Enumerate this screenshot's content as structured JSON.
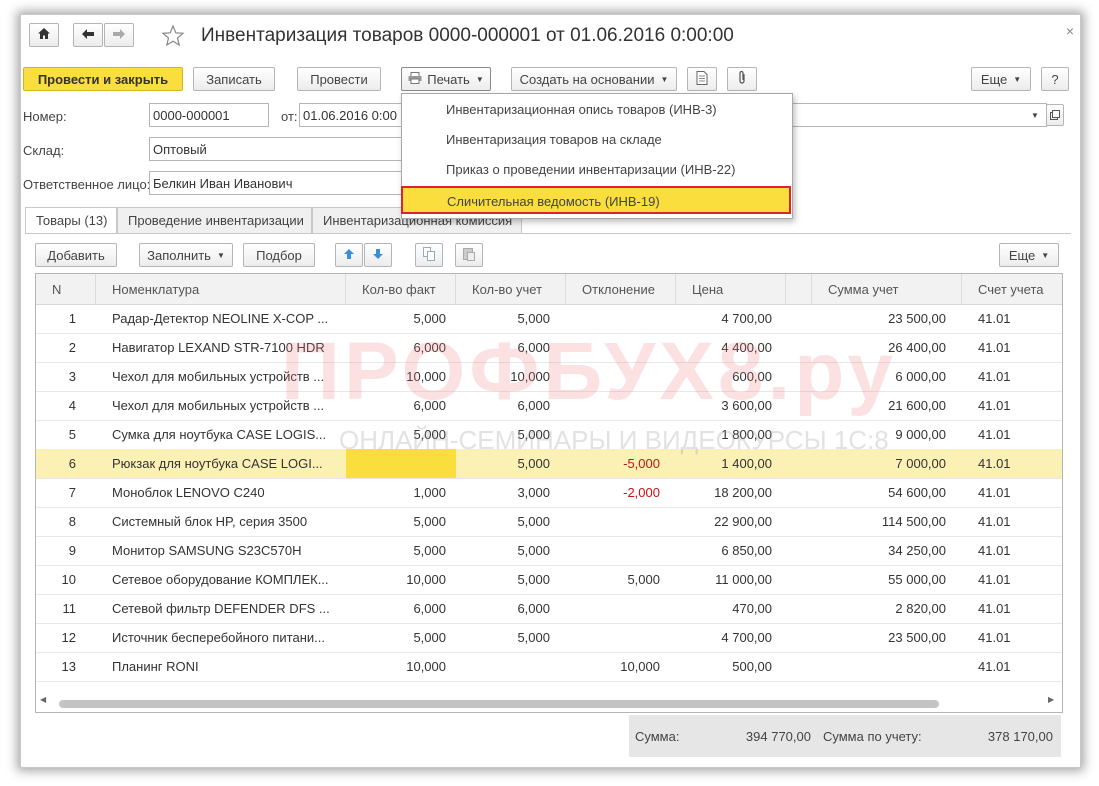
{
  "header": {
    "home_icon": "home-icon",
    "back_icon": "arrow-left-icon",
    "forward_icon": "arrow-right-icon",
    "star_icon": "star-icon",
    "title": "Инвентаризация товаров 0000-000001 от 01.06.2016 0:00:00",
    "close": "×"
  },
  "toolbar": {
    "post_close": "Провести и закрыть",
    "save": "Записать",
    "post": "Провести",
    "print": "Печать",
    "create_based": "Создать на основании",
    "more": "Еще",
    "help": "?"
  },
  "print_menu": {
    "items": [
      "Инвентаризационная опись товаров (ИНВ-3)",
      "Инвентаризация товаров на складе",
      "Приказ о проведении инвентаризации (ИНВ-22)",
      "Сличительная ведомость (ИНВ-19)"
    ],
    "highlighted_index": 3
  },
  "form": {
    "number_label": "Номер:",
    "number_value": "0000-000001",
    "from_label": "от:",
    "date_value": "01.06.2016  0:00",
    "warehouse_label": "Склад:",
    "warehouse_value": "Оптовый",
    "responsible_label": "Ответственное лицо:",
    "responsible_value": "Белкин Иван Иванович"
  },
  "tabs": [
    "Товары (13)",
    "Проведение инвентаризации",
    "Инвентаризационная комиссия"
  ],
  "table_toolbar": {
    "add": "Добавить",
    "fill": "Заполнить",
    "select": "Подбор",
    "more": "Еще"
  },
  "table": {
    "columns": [
      "N",
      "Номенклатура",
      "Кол-во факт",
      "Кол-во учет",
      "Отклонение",
      "Цена",
      "Сумма учет",
      "Счет учета"
    ],
    "rows": [
      [
        "1",
        "Радар-Детектор NEOLINE X-COP ...",
        "5,000",
        "5,000",
        "",
        "4 700,00",
        "23 500,00",
        "41.01"
      ],
      [
        "2",
        "Навигатор LEXAND STR-7100 HDR",
        "6,000",
        "6,000",
        "",
        "4 400,00",
        "26 400,00",
        "41.01"
      ],
      [
        "3",
        "Чехол для мобильных устройств  ...",
        "10,000",
        "10,000",
        "",
        "600,00",
        "6 000,00",
        "41.01"
      ],
      [
        "4",
        "Чехол для мобильных устройств  ...",
        "6,000",
        "6,000",
        "",
        "3 600,00",
        "21 600,00",
        "41.01"
      ],
      [
        "5",
        "Сумка для ноутбука CASE LOGIS...",
        "5,000",
        "5,000",
        "",
        "1 800,00",
        "9 000,00",
        "41.01"
      ],
      [
        "6",
        "Рюкзак для ноутбука CASE LOGI...",
        "",
        "5,000",
        "-5,000",
        "1 400,00",
        "7 000,00",
        "41.01"
      ],
      [
        "7",
        "Моноблок  LENOVO C240",
        "1,000",
        "3,000",
        "-2,000",
        "18 200,00",
        "54 600,00",
        "41.01"
      ],
      [
        "8",
        "Системный блок HP, серия 3500",
        "5,000",
        "5,000",
        "",
        "22 900,00",
        "114 500,00",
        "41.01"
      ],
      [
        "9",
        "Монитор  SAMSUNG S23C570H",
        "5,000",
        "5,000",
        "",
        "6 850,00",
        "34 250,00",
        "41.01"
      ],
      [
        "10",
        "Сетевое оборудование КОМПЛЕК...",
        "10,000",
        "5,000",
        "5,000",
        "11 000,00",
        "55 000,00",
        "41.01"
      ],
      [
        "11",
        "Сетевой фильтр DEFENDER DFS ...",
        "6,000",
        "6,000",
        "",
        "470,00",
        "2 820,00",
        "41.01"
      ],
      [
        "12",
        "Источник бесперебойного  питани...",
        "5,000",
        "5,000",
        "",
        "4 700,00",
        "23 500,00",
        "41.01"
      ],
      [
        "13",
        "Планинг RONI",
        "10,000",
        "",
        "10,000",
        "500,00",
        "",
        "41.01"
      ]
    ],
    "selected_row": 6
  },
  "totals": {
    "sum_label": "Сумма:",
    "sum_value": "394 770,00",
    "acc_label": "Сумма по учету:",
    "acc_value": "378 170,00"
  },
  "watermark": {
    "main": "ПРОФБУХ8.ру",
    "sub": "ОНЛАЙН-СЕМИНАРЫ И ВИДЕОКУРСЫ 1С:8"
  },
  "colors": {
    "accent_yellow": "#f9de3d",
    "highlight_border": "#e0222f",
    "selected_row": "#fbf1b5",
    "negative": "#cc1111"
  }
}
